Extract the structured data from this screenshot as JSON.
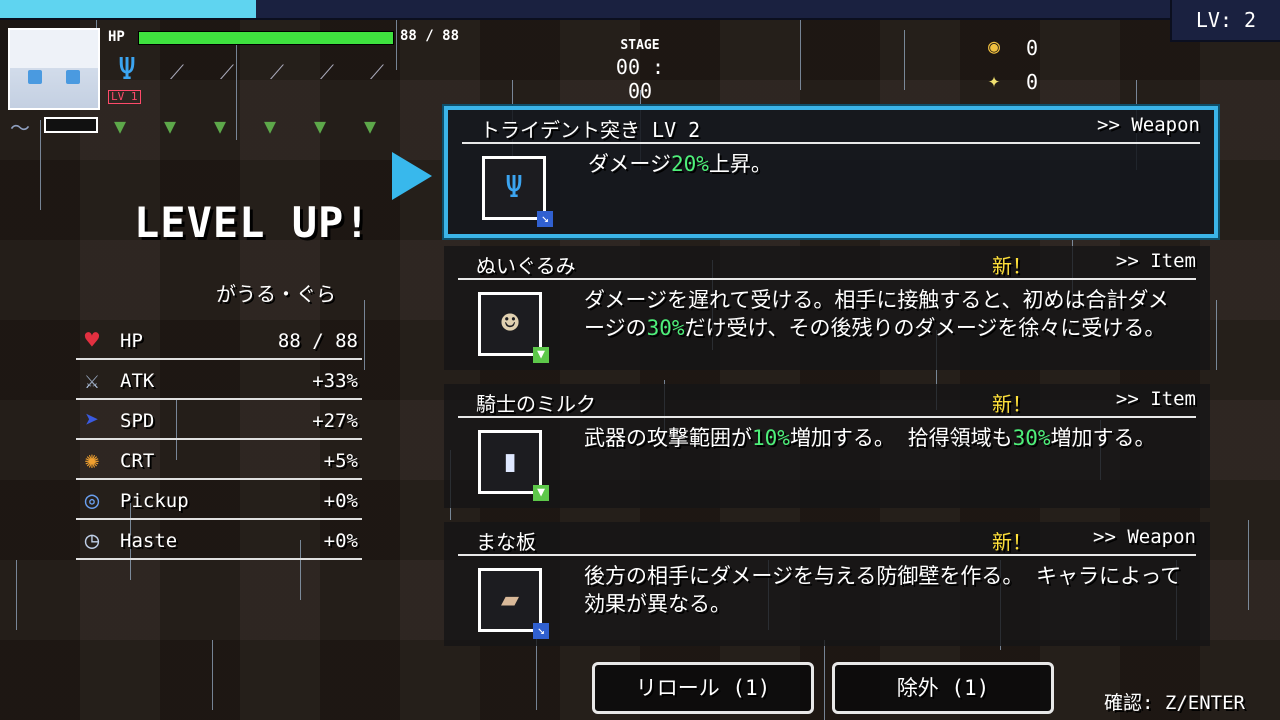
{
  "hud": {
    "level": "LV: 2",
    "hp_label": "HP",
    "hp_value": "88 / 88",
    "hp_fraction": 1.0,
    "xp_fraction": 0.2,
    "weapon_level": "LV 1",
    "stage_label": "STAGE",
    "timer": "00 : 00",
    "coins": "0",
    "kills": "0"
  },
  "levelup": {
    "title": "LEVEL UP!",
    "character": "がうる・ぐら",
    "stats": [
      {
        "name": "HP",
        "value": "88 / 88",
        "icon": "heart-icon"
      },
      {
        "name": "ATK",
        "value": "+33%",
        "icon": "sword-icon"
      },
      {
        "name": "SPD",
        "value": "+27%",
        "icon": "boot-icon"
      },
      {
        "name": "CRT",
        "value": "+5%",
        "icon": "crit-icon"
      },
      {
        "name": "Pickup",
        "value": "+0%",
        "icon": "pickup-icon"
      },
      {
        "name": "Haste",
        "value": "+0%",
        "icon": "clock-icon"
      }
    ]
  },
  "options": [
    {
      "title": "トライデント突き LV 2",
      "type": ">> Weapon",
      "new": "",
      "icon": "trident-icon",
      "desc_parts": [
        "ダメージ",
        "20%",
        "上昇。"
      ]
    },
    {
      "title": "ぬいぐるみ",
      "type": ">> Item",
      "new": "新！",
      "icon": "plush-icon",
      "desc_parts": [
        "ダメージを遅れて受ける。相手に接触すると、初めは合計ダメージの",
        "30%",
        "だけ受け、その後残りのダメージを徐々に受ける。"
      ]
    },
    {
      "title": "騎士のミルク",
      "type": ">> Item",
      "new": "新！",
      "icon": "milk-icon",
      "desc_parts": [
        "武器の攻撃範囲が",
        "10%",
        "増加する。 拾得領域も",
        "30%",
        "増加する。"
      ]
    },
    {
      "title": "まな板",
      "type": ">> Weapon",
      "new": "新！",
      "icon": "cutting-board-icon",
      "desc_parts": [
        "後方の相手にダメージを与える防御壁を作る。 キャラによって効果が異なる。"
      ]
    }
  ],
  "buttons": {
    "reroll": "リロール (1)",
    "exclude": "除外 (1)",
    "confirm": "確認: Z/ENTER"
  },
  "colors": {
    "accent": "#3bb4e8",
    "highlight": "#4ef07a",
    "new": "#ffe13a",
    "hp": "#3fe23f"
  }
}
